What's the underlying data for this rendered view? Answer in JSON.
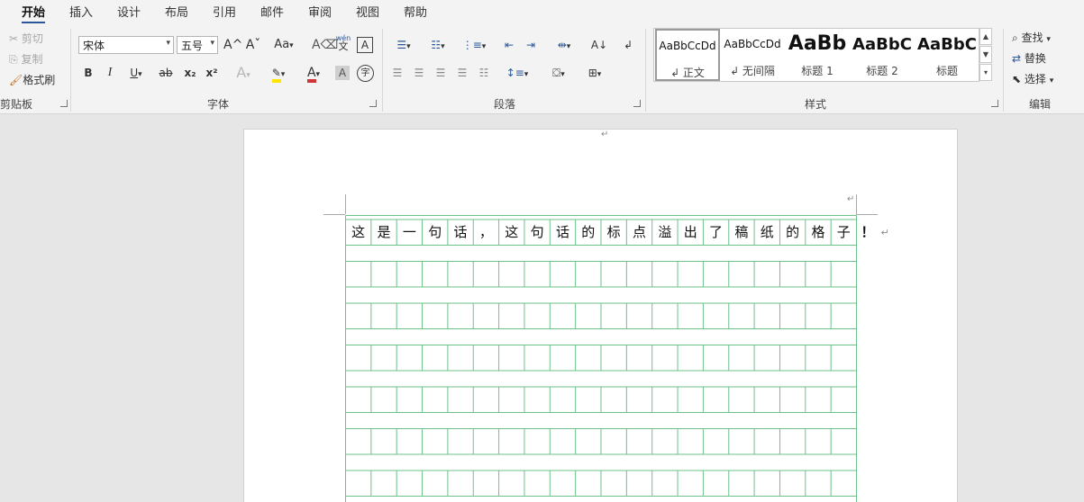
{
  "tabs": [
    "开始",
    "插入",
    "设计",
    "布局",
    "引用",
    "邮件",
    "审阅",
    "视图",
    "帮助"
  ],
  "clipboard": {
    "cut": "剪切",
    "copy": "复制",
    "format_painter": "格式刷",
    "label": "剪贴板"
  },
  "font": {
    "name": "宋体",
    "size": "五号",
    "case": "Aa",
    "label": "字体",
    "phonetic_top": "wén",
    "phonetic_bottom": "文",
    "border_char": "A",
    "char_shading": "A",
    "enclose": "字",
    "effects": "A",
    "color": "A"
  },
  "font_buttons": {
    "bold": "B",
    "italic": "I",
    "underline": "U",
    "strike": "ab",
    "subscript": "x₂",
    "superscript": "x²",
    "grow": "A^",
    "shrink": "Aˇ"
  },
  "paragraph": {
    "label": "段落"
  },
  "styles": {
    "label": "样式",
    "items": [
      {
        "preview": "AaBbCcDd",
        "name": "↲ 正文"
      },
      {
        "preview": "AaBbCcDd",
        "name": "↲ 无间隔"
      },
      {
        "preview": "AaBb",
        "name": "标题 1"
      },
      {
        "preview": "AaBbC",
        "name": "标题 2"
      },
      {
        "preview": "AaBbC",
        "name": "标题"
      }
    ]
  },
  "editing": {
    "find": "查找",
    "replace": "替换",
    "select": "选择",
    "label": "编辑"
  },
  "document": {
    "chars": [
      "这",
      "是",
      "一",
      "句",
      "话",
      "，",
      "这",
      "句",
      "话",
      "的",
      "标",
      "点",
      "溢",
      "出",
      "了",
      "稿",
      "纸",
      "的",
      "格",
      "子"
    ],
    "overflow_char": "！",
    "para_mark": "↵"
  },
  "colors": {
    "grid": "#6cc18a",
    "accent": "#2b579a",
    "highlight": "#ffe600",
    "font_red": "#d13438"
  }
}
